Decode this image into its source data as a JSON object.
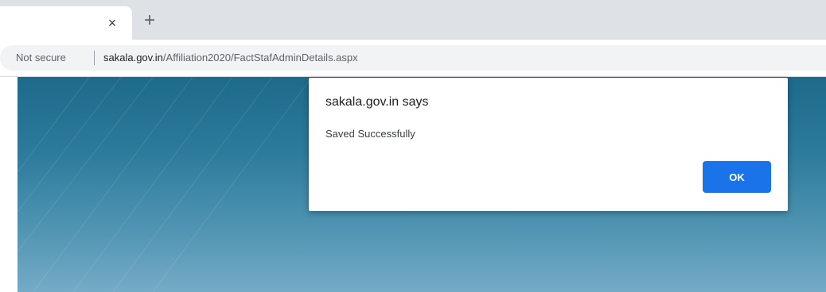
{
  "browser": {
    "tab": {
      "close_glyph": "×",
      "close_icon": "close-icon"
    },
    "new_tab": {
      "glyph": "+",
      "icon": "plus-icon"
    },
    "address_bar": {
      "security_label": "Not secure",
      "url_domain": "sakala.gov.in",
      "url_path": "/Affiliation2020/FactStafAdminDetails.aspx"
    }
  },
  "dialog": {
    "title": "sakala.gov.in says",
    "message": "Saved Successfully",
    "ok_label": "OK"
  },
  "colors": {
    "ok_button": "#1a73e8",
    "page_background_top": "#1d6a8b",
    "page_background_bottom": "#75abc6"
  }
}
